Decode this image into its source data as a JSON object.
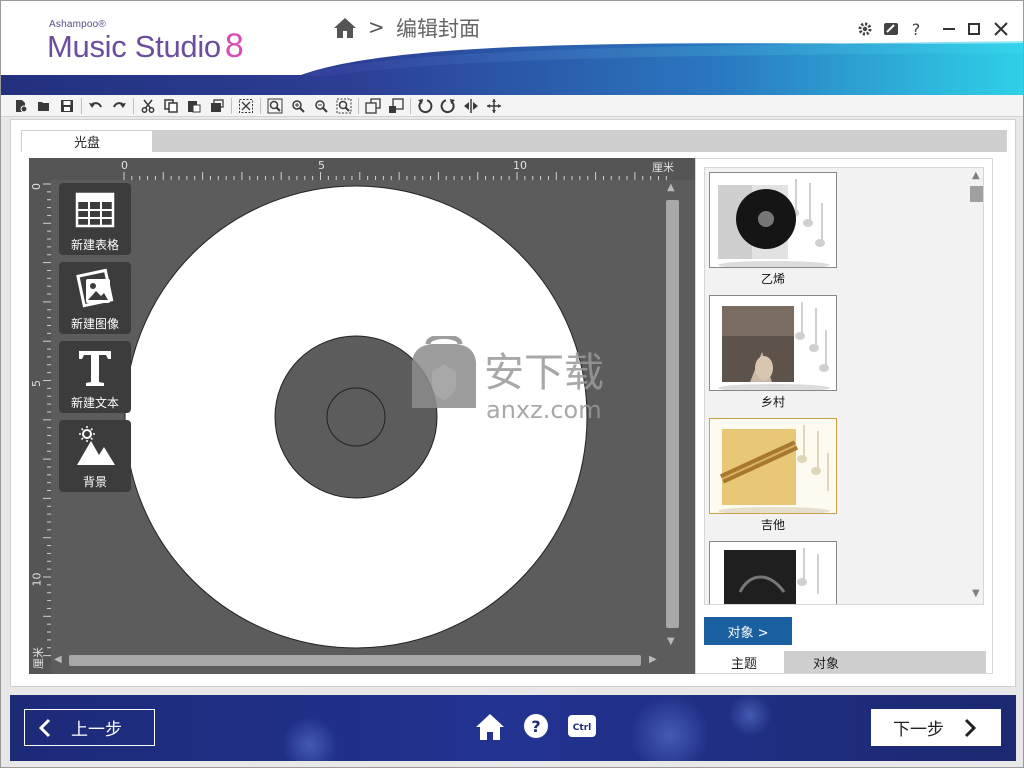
{
  "app": {
    "brand_small": "Ashampoo®",
    "brand_name": "Music Studio",
    "brand_version": "8"
  },
  "header": {
    "breadcrumb_separator": ">",
    "page_title": "编辑封面",
    "help_label": "?"
  },
  "toolbar": {
    "icons": [
      "new-project-icon",
      "open-icon",
      "save-icon",
      "undo-icon",
      "redo-icon",
      "cut-icon",
      "copy-icon",
      "paste-icon",
      "duplicate-icon",
      "select-all-icon",
      "zoom-fit-icon",
      "zoom-in-icon",
      "zoom-out-icon",
      "zoom-actual-icon",
      "bring-front-icon",
      "send-back-icon",
      "rotate-left-icon",
      "rotate-right-icon",
      "flip-horizontal-icon",
      "center-icon"
    ]
  },
  "editor": {
    "tab_label": "光盘",
    "ruler_unit": "厘米",
    "ruler_top_ticks": [
      "0",
      "5",
      "10"
    ],
    "ruler_left_ticks": [
      "0",
      "5",
      "10"
    ],
    "tools": [
      {
        "label": "新建表格",
        "icon": "table-icon"
      },
      {
        "label": "新建图像",
        "icon": "image-icon"
      },
      {
        "label": "新建文本",
        "icon": "text-icon"
      },
      {
        "label": "背景",
        "icon": "background-icon"
      }
    ]
  },
  "themes": {
    "items": [
      {
        "label": "乙烯",
        "selected": false
      },
      {
        "label": "乡村",
        "selected": false
      },
      {
        "label": "吉他",
        "selected": true
      },
      {
        "label": "",
        "selected": false
      }
    ],
    "objects_button": "对象 >",
    "tabs": [
      "主题",
      "对象"
    ],
    "active_tab": "主题"
  },
  "watermark": {
    "text_cn": "安下载",
    "text_en": "anxz.com"
  },
  "footer": {
    "prev_label": "上一步",
    "next_label": "下一步",
    "ctrl_label": "Ctrl",
    "help_label": "?"
  },
  "colors": {
    "canvas_bg": "#5c5c5c",
    "accent_blue": "#1a5fa0",
    "brand_purple": "#6b4e9e",
    "brand_pink": "#d64eb4",
    "footer_bg": "#1e2b7a"
  }
}
